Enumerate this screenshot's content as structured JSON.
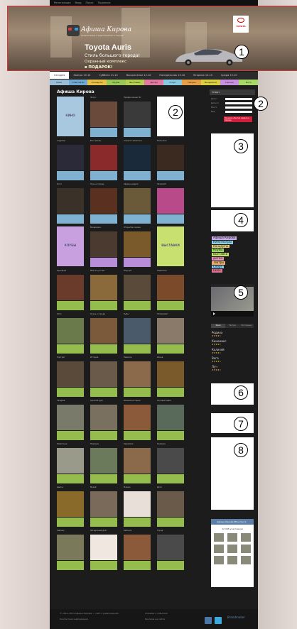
{
  "topbar": {
    "items": [
      "Регистрация",
      "Вход",
      "Поиск",
      "Подписка"
    ]
  },
  "banner": {
    "logo": "Афиша Кирова",
    "logo_sub": "развлечения и мероприятия в городе",
    "model": "Toyota Auris",
    "slogan": "Стиль большого города!",
    "promo_line1": "Охранный комплекс",
    "promo_line2": "в ПОДАРОК!",
    "brand": "TOYOTA"
  },
  "nav_days": [
    "Сегодня",
    "Завтра 10.10",
    "Суббота 11.10",
    "Воскресенье 12.10",
    "Понедельник 13.10",
    "Вторник 14.10",
    "Среда 15.10",
    "Четверг 16.10"
  ],
  "categories": [
    {
      "label": "Кино",
      "color": "#9abcd6"
    },
    {
      "label": "Спектакли",
      "color": "#6fa8d0"
    },
    {
      "label": "Концерты",
      "color": "#e8c048"
    },
    {
      "label": "Клубы",
      "color": "#9ac858"
    },
    {
      "label": "Выставки",
      "color": "#b4d050"
    },
    {
      "label": "Детям",
      "color": "#e07aa0"
    },
    {
      "label": "Спорт",
      "color": "#88c8e0"
    },
    {
      "label": "Театры",
      "color": "#e8a048"
    },
    {
      "label": "Вечеринки",
      "color": "#d8d040"
    },
    {
      "label": "Прочее",
      "color": "#c890e0"
    },
    {
      "label": "Фото",
      "color": "#a8d868"
    }
  ],
  "main": {
    "title": "Афиша Кирова",
    "pads": [
      "КИНО",
      "КЛУБЫ",
      "ВЫСТАВКИ"
    ],
    "cards": [
      {
        "title": "Фокус",
        "color": "#6a4a3a"
      },
      {
        "title": "Профессионал 3D",
        "color": "#3a3a3a"
      },
      {
        "title": "Андроид",
        "color": "#2a2a38"
      },
      {
        "title": "Без границ",
        "color": "#8a2a2a"
      },
      {
        "title": "Стражи галактики",
        "color": "#1a2a3a"
      },
      {
        "title": "Мальчики",
        "color": "#3a2a20"
      },
      {
        "title": "Фото",
        "color": "#3a3228"
      },
      {
        "title": "Ночь в городе",
        "color": "#5a3020"
      },
      {
        "title": "Афиша недели",
        "color": "#6a5a3a"
      },
      {
        "title": "Зажигай!",
        "color": "#b84a8a"
      },
      {
        "title": "Вечеринка",
        "color": "#4a3a30"
      },
      {
        "title": "Открытие сезона",
        "color": "#7a5a2a"
      },
      {
        "title": "Праздник",
        "color": "#6a3a2a"
      },
      {
        "title": "Мир искусства",
        "color": "#8a6a3a"
      },
      {
        "title": "Портрет",
        "color": "#5a4a3a"
      },
      {
        "title": "Живопись",
        "color": "#7a4a2a"
      },
      {
        "title": "Лето",
        "color": "#6a7a4a"
      },
      {
        "title": "Осень в городе",
        "color": "#7a5a3a"
      },
      {
        "title": "Рыбы",
        "color": "#4a5a6a"
      },
      {
        "title": "Натюрморт",
        "color": "#8a7a6a"
      },
      {
        "title": "Портрет",
        "color": "#5a4a3a"
      },
      {
        "title": "История",
        "color": "#6a5a4a"
      },
      {
        "title": "Ремёсла",
        "color": "#8a6a4a"
      },
      {
        "title": "Икона",
        "color": "#7a5a2a"
      },
      {
        "title": "Галерея",
        "color": "#7a7a6a"
      },
      {
        "title": "Архитектура",
        "color": "#7a7060"
      },
      {
        "title": "Военная история",
        "color": "#8a5a3a"
      },
      {
        "title": "Фотовыставка",
        "color": "#5a6a5a"
      },
      {
        "title": "Животные",
        "color": "#9a9a8a"
      },
      {
        "title": "Природа",
        "color": "#6a7a5a"
      },
      {
        "title": "Керамика",
        "color": "#8a6a4a"
      },
      {
        "title": "Гравюра",
        "color": "#4a4a4a"
      },
      {
        "title": "Цветы",
        "color": "#8a6a2a"
      },
      {
        "title": "Музей",
        "color": "#7a6a5a"
      },
      {
        "title": "Picasso",
        "color": "#e8e0d8"
      },
      {
        "title": "Дети",
        "color": "#6a5a4a"
      },
      {
        "title": "Пейзаж",
        "color": "#7a7a5a"
      },
      {
        "title": "Загадочный дом",
        "color": "#f0e8e0"
      },
      {
        "title": "Бабочки",
        "color": "#8a5a3a"
      },
      {
        "title": "Город",
        "color": "#4a4a4a"
      },
      {
        "title": "Гравюра",
        "color": "#8a7a5a"
      },
      {
        "title": "Картины",
        "color": "#7a6a5a"
      },
      {
        "title": "Ремесло",
        "color": "#8a5a4a"
      },
      {
        "title": "Портрет",
        "color": "#5a5a5a"
      }
    ]
  },
  "sidebar": {
    "search_title": "Спорт",
    "search_rows": [
      "Дата с",
      "Дата по",
      "Место",
      "Вид"
    ],
    "promo_text": "Лучшие события недели в Кирове",
    "cat_list": [
      "Афиша Кирова",
      "Кинотеатры",
      "Концерты",
      "Клубы",
      "Выставки",
      "Детям",
      "Театры",
      "Спорт",
      "Fame"
    ],
    "tabs": [
      "Кино",
      "Театры",
      "Рестораны"
    ],
    "ratings": [
      "Родина",
      "Киномакс",
      "Колизей",
      "Вега",
      "Луч"
    ],
    "vk_title": "Афиша Кирова ВКонтакте",
    "vk_count": "12 345 участников"
  },
  "markers": [
    "1",
    "2",
    "2",
    "3",
    "4",
    "5",
    "6",
    "7",
    "8"
  ],
  "footer": {
    "copyright": "© 2010–2014 Афиша Кирова — сайт о развлечениях",
    "info": "Контактная информация",
    "links": [
      "Справка о событиях",
      "Реклама на сайте"
    ],
    "credit": "Brandmaker"
  }
}
